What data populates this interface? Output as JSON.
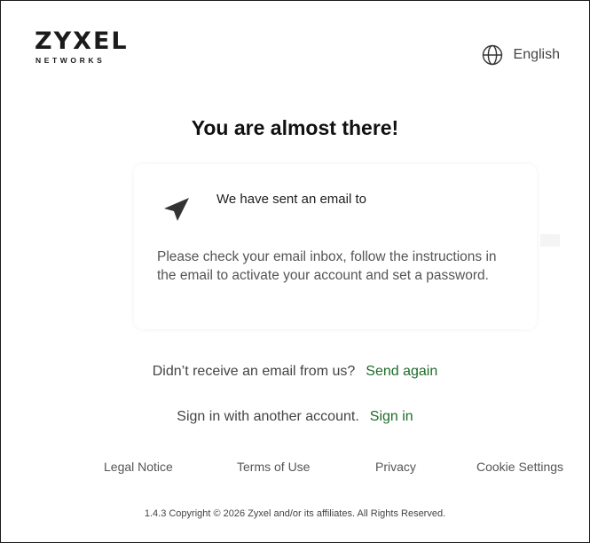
{
  "brand": {
    "logo_main": "ZYXEL",
    "logo_sub": "NETWORKS"
  },
  "header": {
    "language_icon": "globe-icon",
    "language_label": "English"
  },
  "main": {
    "heading": "You are almost there!",
    "card": {
      "icon": "send-plane-icon",
      "sent_text": "We have sent an email to",
      "instructions": "Please check your email inbox, follow the instructions in the email to activate your account and set a password."
    },
    "resend": {
      "prompt": "Didn’t receive an email from us?",
      "link": "Send again"
    },
    "signin": {
      "prompt": "Sign in with another account.",
      "link": "Sign in"
    }
  },
  "footer": {
    "links": [
      "Legal Notice",
      "Terms of Use",
      "Privacy",
      "Cookie Settings"
    ],
    "copyright": "1.4.3 Copyright © 2026 Zyxel and/or its affiliates. All Rights Reserved."
  },
  "colors": {
    "link_green": "#1f6b2a",
    "text_dark": "#111111",
    "text_muted": "#555555"
  }
}
